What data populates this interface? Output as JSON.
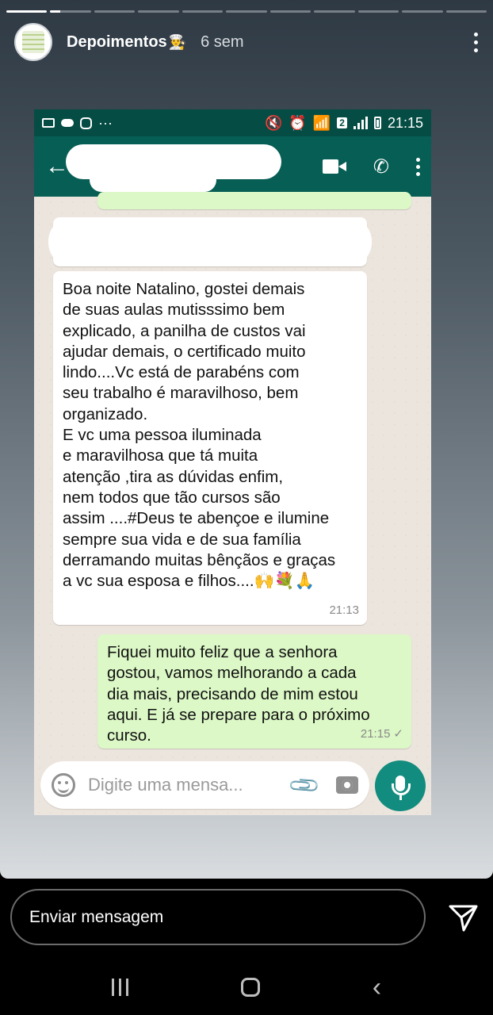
{
  "story": {
    "username": "Depoimentos",
    "username_emoji": "👨‍🍳",
    "time_ago": "6 sem",
    "progress_segments_total": 11,
    "progress_segments_done": 1
  },
  "screenshot": {
    "status_bar": {
      "sim_badge": "2",
      "time": "21:15"
    },
    "messages": [
      {
        "direction": "incoming",
        "text": "Boa noite Natalino, gostei demais\nde suas aulas mutisssimo bem\nexplicado, a panilha de custos vai\najudar demais, o certificado muito\nlindo....Vc está de parabéns com\nseu trabalho é maravilhoso, bem\norganizado.\nE vc uma pessoa iluminada\ne maravilhosa que tá muita\natenção ,tira as dúvidas enfim,\nnem todos que tão cursos são\nassim ....#Deus te abençoe e ilumine\nsempre sua vida e de sua família\nderramando muitas bênçãos e graças\na vc sua esposa e filhos....🙌💐🙏",
        "time": "21:13"
      },
      {
        "direction": "outgoing",
        "text": "Fiquei muito feliz que a senhora\ngostou, vamos melhorando a cada\ndia mais, precisando de mim estou\naqui. E já se prepare para o próximo\ncurso.",
        "time": "21:15",
        "status_icon": "✓"
      }
    ],
    "composer": {
      "placeholder": "Digite uma mensa..."
    }
  },
  "reply": {
    "placeholder": "Enviar mensagem"
  },
  "colors": {
    "whatsapp_header": "#075e54",
    "outgoing_bubble": "#dcf8c6",
    "mic_button": "#128c7e"
  }
}
